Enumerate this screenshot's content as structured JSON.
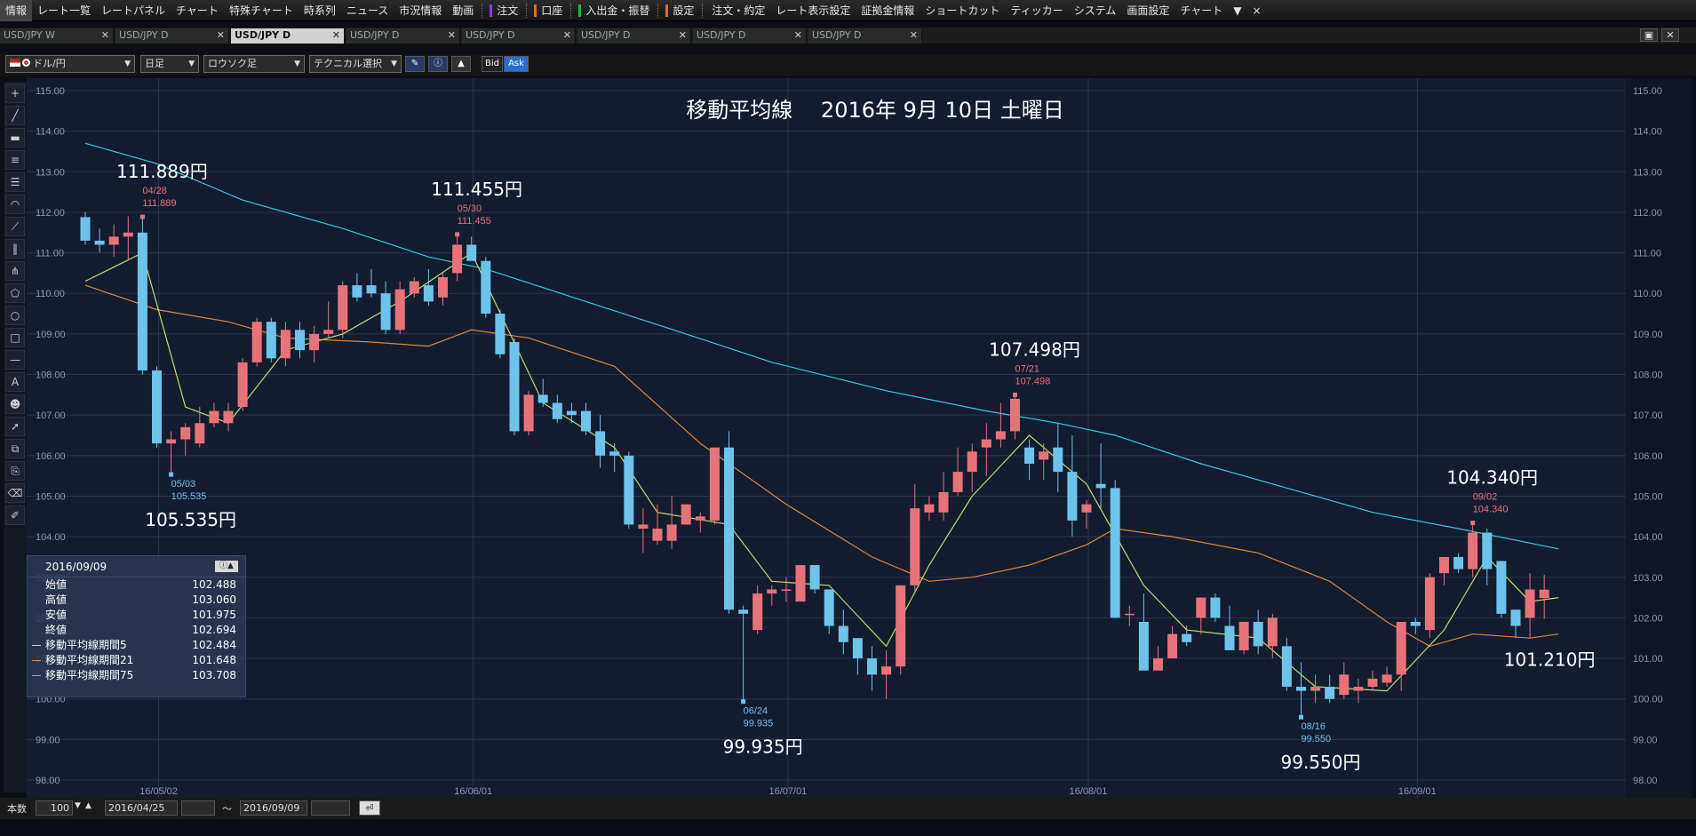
{
  "menu": {
    "items": [
      "情報",
      "レート一覧",
      "レートパネル",
      "チャート",
      "特殊チャート",
      "時系列",
      "ニュース",
      "市況情報",
      "動画"
    ],
    "marked": [
      {
        "label": "注文",
        "color": "#8a3ddb"
      },
      {
        "label": "口座",
        "color": "#e07010"
      },
      {
        "label": "入出金・振替",
        "color": "#2fae3a"
      },
      {
        "label": "設定",
        "color": "#e07010"
      }
    ],
    "right_items": [
      "注文・約定",
      "レート表示設定",
      "証拠金情報",
      "ショートカット",
      "ティッカー",
      "システム",
      "画面設定",
      "チャート"
    ],
    "more_icon": "▼",
    "close_icon": "×"
  },
  "tabs": [
    {
      "label": "USD/JPY W",
      "active": false
    },
    {
      "label": "USD/JPY D",
      "active": false
    },
    {
      "label": "USD/JPY D",
      "active": true
    },
    {
      "label": "USD/JPY D",
      "active": false
    },
    {
      "label": "USD/JPY D",
      "active": false
    },
    {
      "label": "USD/JPY D",
      "active": false
    },
    {
      "label": "USD/JPY D",
      "active": false
    },
    {
      "label": "USD/JPY D",
      "active": false
    }
  ],
  "toolbar": {
    "pair": "ドル/円",
    "timeframe": "日足",
    "chart_type": "ロウソク足",
    "technical": "テクニカル選択",
    "bid_label": "Bid",
    "ask_label": "Ask"
  },
  "bottom": {
    "count_label": "本数",
    "count_value": "100",
    "date_from": "2016/04/25",
    "tilde": "～",
    "date_to": "2016/09/09"
  },
  "panel": {
    "date": "2016/09/09",
    "rows": [
      {
        "label": "始値",
        "value": "102.488",
        "color": ""
      },
      {
        "label": "高値",
        "value": "103.060",
        "color": ""
      },
      {
        "label": "安値",
        "value": "101.975",
        "color": ""
      },
      {
        "label": "終値",
        "value": "102.694",
        "color": ""
      },
      {
        "label": "移動平均線期間5",
        "value": "102.484",
        "color": "#b8e06a"
      },
      {
        "label": "移動平均線期間21",
        "value": "101.648",
        "color": "#e0863a"
      },
      {
        "label": "移動平均線期間75",
        "value": "103.708",
        "color": "#3cc8dc"
      }
    ]
  },
  "chart_data": {
    "type": "candlestick",
    "title": "移動平均線　 2016年 9月 10日 土曜日",
    "ylim": [
      98.0,
      115.0
    ],
    "y_ticks": [
      "115.00",
      "114.00",
      "113.00",
      "112.00",
      "111.00",
      "110.00",
      "109.00",
      "108.00",
      "107.00",
      "106.00",
      "105.00",
      "104.00",
      "103.00",
      "102.00",
      "101.00",
      "100.00",
      "99.00",
      "98.00"
    ],
    "x_ticks": [
      {
        "label": "16/05/02",
        "index": 5
      },
      {
        "label": "16/06/01",
        "index": 27
      },
      {
        "label": "16/07/01",
        "index": 49
      },
      {
        "label": "16/08/01",
        "index": 70
      },
      {
        "label": "16/09/01",
        "index": 93
      }
    ],
    "colors": {
      "up": "#e8727a",
      "down": "#6ec3ea",
      "grid": "#2a3550",
      "bg": "#141c30",
      "ma5": "#b8e06a",
      "ma21": "#e0863a",
      "ma75": "#3cc8dc"
    },
    "candles": [
      [
        111.88,
        112.0,
        111.2,
        111.3
      ],
      [
        111.3,
        111.6,
        111.0,
        111.2
      ],
      [
        111.2,
        111.7,
        110.9,
        111.4
      ],
      [
        111.4,
        111.9,
        110.8,
        111.5
      ],
      [
        111.5,
        111.89,
        108.0,
        108.1
      ],
      [
        108.1,
        108.2,
        106.2,
        106.3
      ],
      [
        106.3,
        106.6,
        105.535,
        106.4
      ],
      [
        106.4,
        106.8,
        106.0,
        106.7
      ],
      [
        106.3,
        107.2,
        106.2,
        106.8
      ],
      [
        106.8,
        107.3,
        106.7,
        107.1
      ],
      [
        106.8,
        107.3,
        106.6,
        107.1
      ],
      [
        107.2,
        108.4,
        107.1,
        108.3
      ],
      [
        108.3,
        109.4,
        108.2,
        109.3
      ],
      [
        109.3,
        109.4,
        108.3,
        108.4
      ],
      [
        108.4,
        109.3,
        108.2,
        109.1
      ],
      [
        109.1,
        109.3,
        108.4,
        108.6
      ],
      [
        108.6,
        109.2,
        108.3,
        109.0
      ],
      [
        109.0,
        109.8,
        108.9,
        109.1
      ],
      [
        109.1,
        110.3,
        108.9,
        110.2
      ],
      [
        110.2,
        110.5,
        109.8,
        109.9
      ],
      [
        110.2,
        110.6,
        109.9,
        110.0
      ],
      [
        110.0,
        110.3,
        109.0,
        109.1
      ],
      [
        109.1,
        110.3,
        109.0,
        110.1
      ],
      [
        110.0,
        110.4,
        109.9,
        110.3
      ],
      [
        110.2,
        110.6,
        109.7,
        109.8
      ],
      [
        109.9,
        110.5,
        109.7,
        110.4
      ],
      [
        110.5,
        111.455,
        110.3,
        111.2
      ],
      [
        111.2,
        111.4,
        110.9,
        110.8
      ],
      [
        110.8,
        110.9,
        109.4,
        109.5
      ],
      [
        109.5,
        109.6,
        108.4,
        108.5
      ],
      [
        108.8,
        108.9,
        106.5,
        106.6
      ],
      [
        106.6,
        107.6,
        106.5,
        107.5
      ],
      [
        107.5,
        107.9,
        107.2,
        107.3
      ],
      [
        107.3,
        107.5,
        106.8,
        106.9
      ],
      [
        107.1,
        107.3,
        106.8,
        107.0
      ],
      [
        107.1,
        107.3,
        106.5,
        106.6
      ],
      [
        106.6,
        107.0,
        105.7,
        106.0
      ],
      [
        106.1,
        106.3,
        105.6,
        106.0
      ],
      [
        106.0,
        106.1,
        104.2,
        104.3
      ],
      [
        104.2,
        104.7,
        103.6,
        104.3
      ],
      [
        103.9,
        104.8,
        103.8,
        104.2
      ],
      [
        103.9,
        105.0,
        103.7,
        104.3
      ],
      [
        104.3,
        104.8,
        104.4,
        104.8
      ],
      [
        104.4,
        104.6,
        104.1,
        104.5
      ],
      [
        104.4,
        105.5,
        104.3,
        106.2
      ],
      [
        106.2,
        106.6,
        102.1,
        102.2
      ],
      [
        102.2,
        102.3,
        99.935,
        102.1
      ],
      [
        101.7,
        102.8,
        101.6,
        102.6
      ],
      [
        102.6,
        102.8,
        102.3,
        102.7
      ],
      [
        102.7,
        103.0,
        102.4,
        102.7
      ],
      [
        102.4,
        103.3,
        102.6,
        103.3
      ],
      [
        103.3,
        103.3,
        102.6,
        102.7
      ],
      [
        102.7,
        102.7,
        101.6,
        101.8
      ],
      [
        101.8,
        102.2,
        101.1,
        101.4
      ],
      [
        101.5,
        101.5,
        100.6,
        101.0
      ],
      [
        101.0,
        101.3,
        100.2,
        100.6
      ],
      [
        100.6,
        101.2,
        100.0,
        100.8
      ],
      [
        100.8,
        102.8,
        100.6,
        102.8
      ],
      [
        102.8,
        105.3,
        102.6,
        104.7
      ],
      [
        104.6,
        105.0,
        104.4,
        104.8
      ],
      [
        104.6,
        105.6,
        104.4,
        105.1
      ],
      [
        105.1,
        106.2,
        105.0,
        105.6
      ],
      [
        105.6,
        106.3,
        105.1,
        106.1
      ],
      [
        106.2,
        106.8,
        105.5,
        106.4
      ],
      [
        106.4,
        107.3,
        106.2,
        106.6
      ],
      [
        106.6,
        107.498,
        106.4,
        107.4
      ],
      [
        106.2,
        106.4,
        105.4,
        105.8
      ],
      [
        105.9,
        106.3,
        105.4,
        106.1
      ],
      [
        106.2,
        106.8,
        105.1,
        105.6
      ],
      [
        105.6,
        106.5,
        104.0,
        104.4
      ],
      [
        104.6,
        104.9,
        104.2,
        104.8
      ],
      [
        105.3,
        106.3,
        104.7,
        105.2
      ],
      [
        105.2,
        105.4,
        102.0,
        102.0
      ],
      [
        102.1,
        102.3,
        101.8,
        102.1
      ],
      [
        101.9,
        102.6,
        100.8,
        100.7
      ],
      [
        100.7,
        101.3,
        100.8,
        101.0
      ],
      [
        101.0,
        101.8,
        101.0,
        101.6
      ],
      [
        101.6,
        101.8,
        101.3,
        101.4
      ],
      [
        102.0,
        102.5,
        101.6,
        102.5
      ],
      [
        102.5,
        102.6,
        101.9,
        102.0
      ],
      [
        101.8,
        102.3,
        101.2,
        101.2
      ],
      [
        101.2,
        101.8,
        101.1,
        101.9
      ],
      [
        101.9,
        102.2,
        101.1,
        101.3
      ],
      [
        101.3,
        102.1,
        101.0,
        102.0
      ],
      [
        101.3,
        101.5,
        100.2,
        100.3
      ],
      [
        100.3,
        100.9,
        99.55,
        100.2
      ],
      [
        100.2,
        100.6,
        99.9,
        100.3
      ],
      [
        100.3,
        100.6,
        99.9,
        100.0
      ],
      [
        100.1,
        100.9,
        100.0,
        100.6
      ],
      [
        100.2,
        100.5,
        99.9,
        100.3
      ],
      [
        100.3,
        100.7,
        100.2,
        100.5
      ],
      [
        100.4,
        100.8,
        100.3,
        100.6
      ],
      [
        100.6,
        101.8,
        100.2,
        101.9
      ],
      [
        101.9,
        102.0,
        101.6,
        101.8
      ],
      [
        101.7,
        103.1,
        101.5,
        103.0
      ],
      [
        103.1,
        103.4,
        102.8,
        103.5
      ],
      [
        103.5,
        103.6,
        103.1,
        103.2
      ],
      [
        103.2,
        104.34,
        103.0,
        104.1
      ],
      [
        104.1,
        104.2,
        102.8,
        103.2
      ],
      [
        103.4,
        103.4,
        102.0,
        102.1
      ],
      [
        102.2,
        102.0,
        101.5,
        101.8
      ],
      [
        102.0,
        103.1,
        101.5,
        102.7
      ],
      [
        102.488,
        103.06,
        101.975,
        102.694
      ]
    ],
    "ma5": [
      [
        0,
        110.3
      ],
      [
        4,
        111.0
      ],
      [
        7,
        107.2
      ],
      [
        10,
        106.8
      ],
      [
        14,
        108.6
      ],
      [
        18,
        109.0
      ],
      [
        22,
        109.8
      ],
      [
        27,
        111.0
      ],
      [
        32,
        107.3
      ],
      [
        37,
        106.2
      ],
      [
        40,
        104.6
      ],
      [
        45,
        104.3
      ],
      [
        48,
        102.9
      ],
      [
        52,
        102.8
      ],
      [
        56,
        101.3
      ],
      [
        59,
        103.3
      ],
      [
        62,
        105.0
      ],
      [
        66,
        106.5
      ],
      [
        70,
        105.3
      ],
      [
        74,
        102.8
      ],
      [
        77,
        101.7
      ],
      [
        82,
        101.5
      ],
      [
        86,
        100.3
      ],
      [
        91,
        100.2
      ],
      [
        95,
        101.7
      ],
      [
        98,
        103.5
      ],
      [
        101,
        102.4
      ],
      [
        103,
        102.5
      ]
    ],
    "ma21": [
      [
        0,
        110.2
      ],
      [
        5,
        109.6
      ],
      [
        10,
        109.3
      ],
      [
        14,
        108.9
      ],
      [
        20,
        108.8
      ],
      [
        24,
        108.7
      ],
      [
        27,
        109.1
      ],
      [
        31,
        108.9
      ],
      [
        37,
        108.2
      ],
      [
        43,
        106.3
      ],
      [
        49,
        104.8
      ],
      [
        55,
        103.5
      ],
      [
        59,
        102.9
      ],
      [
        62,
        103.0
      ],
      [
        66,
        103.3
      ],
      [
        70,
        103.8
      ],
      [
        72,
        104.2
      ],
      [
        76,
        104.0
      ],
      [
        82,
        103.6
      ],
      [
        87,
        102.9
      ],
      [
        91,
        101.9
      ],
      [
        94,
        101.3
      ],
      [
        97,
        101.6
      ],
      [
        101,
        101.5
      ],
      [
        103,
        101.6
      ]
    ],
    "ma75": [
      [
        0,
        113.7
      ],
      [
        5,
        113.2
      ],
      [
        11,
        112.3
      ],
      [
        18,
        111.6
      ],
      [
        24,
        110.9
      ],
      [
        28,
        110.6
      ],
      [
        35,
        109.8
      ],
      [
        42,
        109.0
      ],
      [
        48,
        108.3
      ],
      [
        56,
        107.6
      ],
      [
        63,
        107.1
      ],
      [
        68,
        106.8
      ],
      [
        72,
        106.5
      ],
      [
        78,
        105.8
      ],
      [
        84,
        105.2
      ],
      [
        90,
        104.6
      ],
      [
        96,
        104.2
      ],
      [
        103,
        103.7
      ]
    ],
    "annotations": [
      {
        "big": "111.889円",
        "date": "04/28",
        "val": "111.889",
        "idx": 4,
        "price": 111.889,
        "pos": "above"
      },
      {
        "big": "105.535円",
        "date": "05/03",
        "val": "105.535",
        "idx": 6,
        "price": 105.535,
        "pos": "below"
      },
      {
        "big": "111.455円",
        "date": "05/30",
        "val": "111.455",
        "idx": 26,
        "price": 111.455,
        "pos": "above"
      },
      {
        "big": "99.935円",
        "date": "06/24",
        "val": "99.935",
        "idx": 46,
        "price": 99.935,
        "pos": "below"
      },
      {
        "big": "107.498円",
        "date": "07/21",
        "val": "107.498",
        "idx": 65,
        "price": 107.498,
        "pos": "above"
      },
      {
        "big": "99.550円",
        "date": "08/16",
        "val": "99.550",
        "idx": 85,
        "price": 99.55,
        "pos": "below"
      },
      {
        "big": "104.340円",
        "date": "09/02",
        "val": "104.340",
        "idx": 97,
        "price": 104.34,
        "pos": "above"
      },
      {
        "big": "101.210円",
        "date": "",
        "val": "",
        "idx": 101,
        "price": 101.21,
        "pos": "below"
      }
    ]
  }
}
